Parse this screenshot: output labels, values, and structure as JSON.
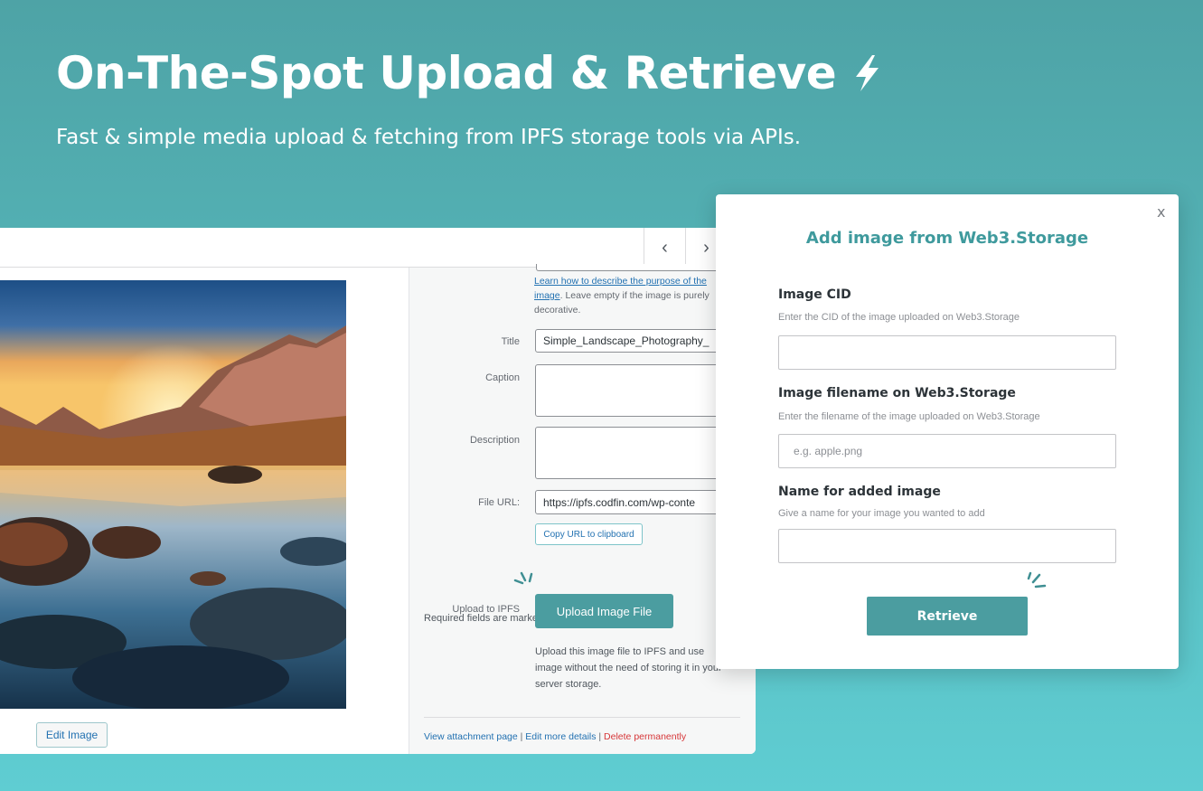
{
  "hero": {
    "title": "On-The-Spot Upload & Retrieve",
    "subtitle": "Fast & simple media upload & fetching from IPFS storage tools via APIs."
  },
  "media": {
    "alt_help_link": "Learn how to describe the purpose of the image",
    "alt_help_rest": ". Leave empty if the image is purely decorative.",
    "title_label": "Title",
    "title_value": "Simple_Landscape_Photography_",
    "caption_label": "Caption",
    "description_label": "Description",
    "file_url_label": "File URL:",
    "file_url_value": "https://ipfs.codfin.com/wp-conte",
    "copy_url_button": "Copy URL to clipboard",
    "required_text": "Required fields are marked",
    "required_star": "*",
    "upload_label": "Upload to IPFS",
    "upload_button": "Upload Image File",
    "upload_help": "Upload this image file to IPFS and use image without the need of storing it in your server storage.",
    "edit_image_button": "Edit Image",
    "footer": {
      "view_attachment": "View attachment page",
      "separator": " | ",
      "edit_more": "Edit more details",
      "delete": "Delete permanently"
    },
    "nav_prev": "‹",
    "nav_next": "›"
  },
  "modal": {
    "close": "x",
    "title": "Add image from Web3.Storage",
    "cid_label": "Image CID",
    "cid_help": "Enter the CID of the image uploaded on Web3.Storage",
    "cid_value": "",
    "filename_label": "Image filename on Web3.Storage",
    "filename_help": "Enter the filename of the image uploaded on Web3.Storage",
    "filename_placeholder": "e.g. apple.png",
    "name_label": "Name for added image",
    "name_help": "Give a name for your image you wanted to add",
    "name_value": "",
    "retrieve_button": "Retrieve"
  },
  "colors": {
    "accent": "#4b9da0",
    "title_teal": "#3f9a9d",
    "link": "#2271b1",
    "danger": "#d63638"
  },
  "icons": [
    "lightning-bolt-icon",
    "chevron-left-icon",
    "chevron-right-icon",
    "close-icon",
    "sparkle-icon"
  ]
}
